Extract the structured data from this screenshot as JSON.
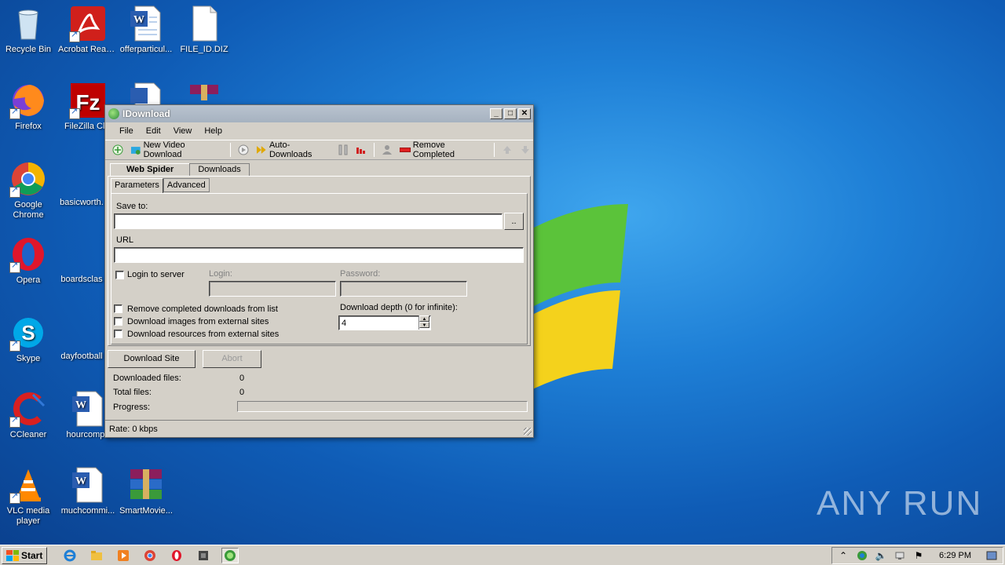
{
  "desktop": {
    "icons": [
      {
        "label": "Recycle Bin"
      },
      {
        "label": "Acrobat Reader DC"
      },
      {
        "label": "offerparticul..."
      },
      {
        "label": "FILE_ID.DIZ"
      },
      {
        "label": "Firefox"
      },
      {
        "label": "FileZilla Clie"
      },
      {
        "label": "Google Chrome"
      },
      {
        "label": "basicworth."
      },
      {
        "label": "Opera"
      },
      {
        "label": "boardsclas"
      },
      {
        "label": "Skype"
      },
      {
        "label": "dayfootball"
      },
      {
        "label": "CCleaner"
      },
      {
        "label": "hourcompa"
      },
      {
        "label": "VLC media player"
      },
      {
        "label": "muchcommi..."
      },
      {
        "label": "SmartMovie..."
      }
    ],
    "watermark": "ANY RUN"
  },
  "window": {
    "title": "IDownload",
    "menu": [
      "File",
      "Edit",
      "View",
      "Help"
    ],
    "toolbar": {
      "new_video": "New Video Download",
      "auto_downloads": "Auto-Downloads",
      "remove_completed": "Remove Completed"
    },
    "tabs": [
      "Web Spider",
      "Downloads"
    ],
    "subtabs": [
      "Parameters",
      "Advanced"
    ],
    "form": {
      "save_to_label": "Save to:",
      "save_to_value": "",
      "browse_label": "..",
      "url_label": "URL",
      "url_value": "",
      "login_to_server": "Login to server",
      "login_label": "Login:",
      "password_label": "Password:",
      "remove_completed": "Remove completed downloads from list",
      "download_images": "Download images from external sites",
      "download_resources": "Download resources from external sites",
      "depth_label": "Download depth (0 for infinite):",
      "depth_value": "4"
    },
    "actions": {
      "download_site": "Download Site",
      "abort": "Abort"
    },
    "stats": {
      "downloaded_files_label": "Downloaded files:",
      "downloaded_files_value": "0",
      "total_files_label": "Total files:",
      "total_files_value": "0",
      "progress_label": "Progress:",
      "progress_fraction": 0
    },
    "status": "Rate:  0 kbps"
  },
  "taskbar": {
    "start": "Start",
    "clock": "6:29 PM"
  }
}
